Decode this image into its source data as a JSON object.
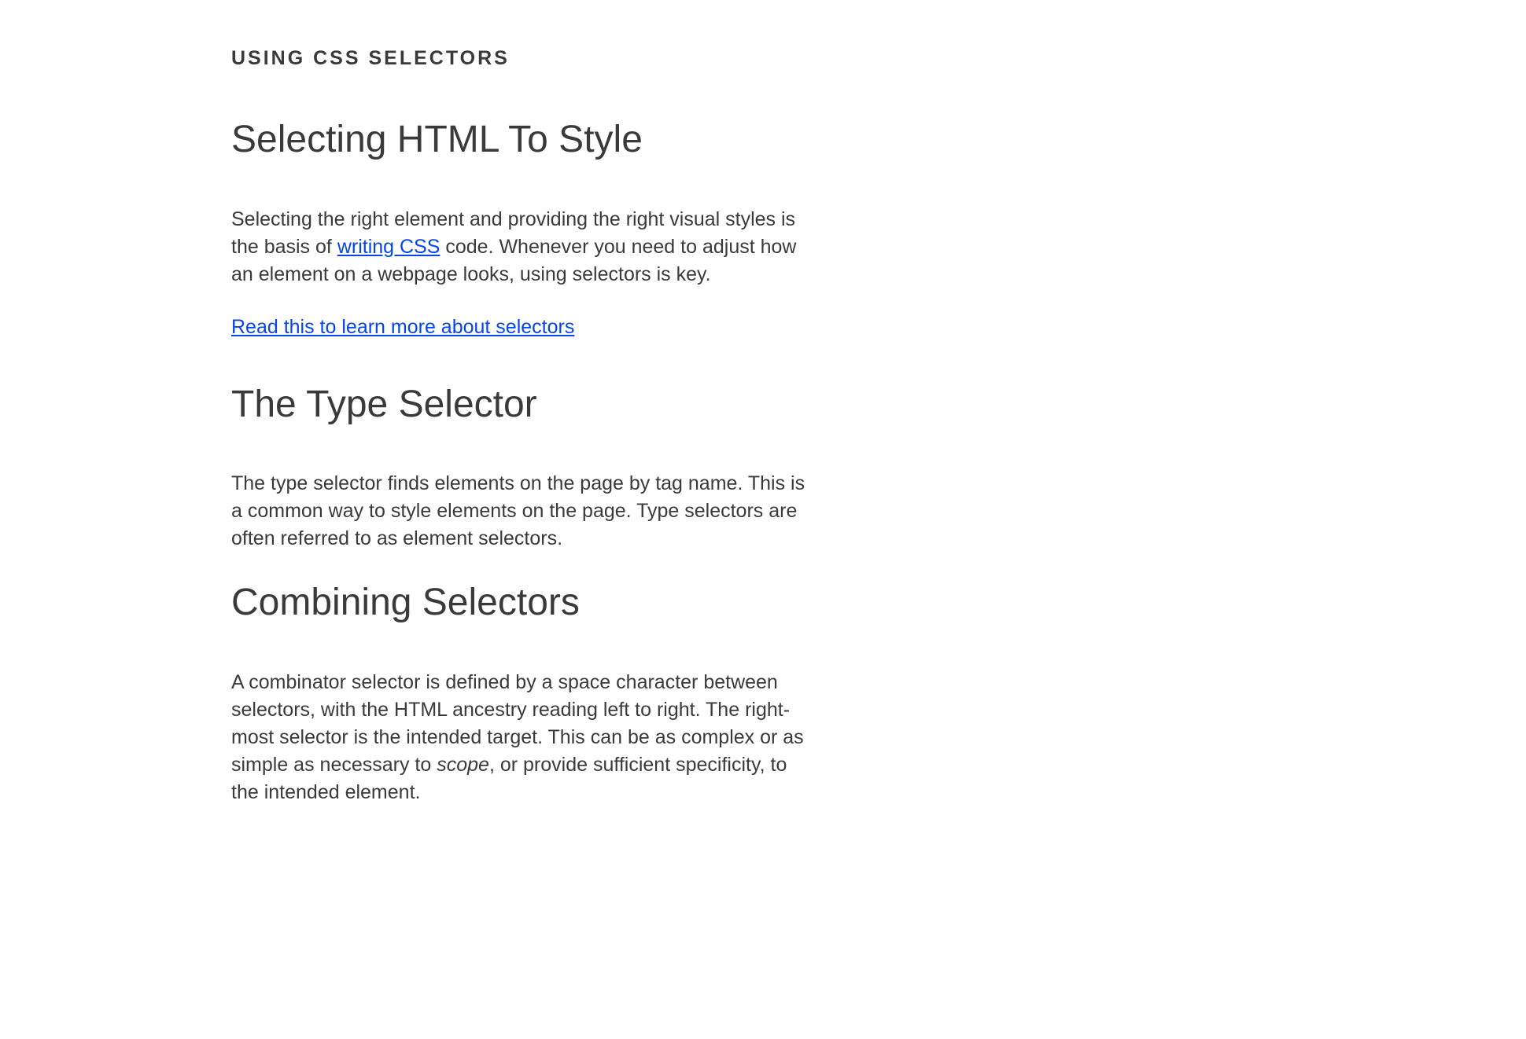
{
  "eyebrow": "USING CSS SELECTORS",
  "h1": "Selecting HTML To Style",
  "intro": {
    "p1_pre": "Selecting the right element and providing the right visual styles is the basis of ",
    "p1_link": "writing CSS",
    "p1_post": " code. Whenever you need to adjust how an element on a webpage looks, using selectors is key.",
    "read_more": "Read this to learn more about selectors"
  },
  "section_type": {
    "heading": "The Type Selector",
    "body": "The type selector finds elements on the page by tag name. This is a common way to style elements on the page. Type selectors are often referred to as element selectors."
  },
  "section_combining": {
    "heading": "Combining Selectors",
    "body_pre": "A combinator selector is defined by a space character between selectors, with the HTML ancestry reading left to right. The right-most selector is the intended target. This can be as complex or as simple as necessary to ",
    "body_em": "scope",
    "body_post": ", or provide sufficient specificity, to the intended element."
  }
}
